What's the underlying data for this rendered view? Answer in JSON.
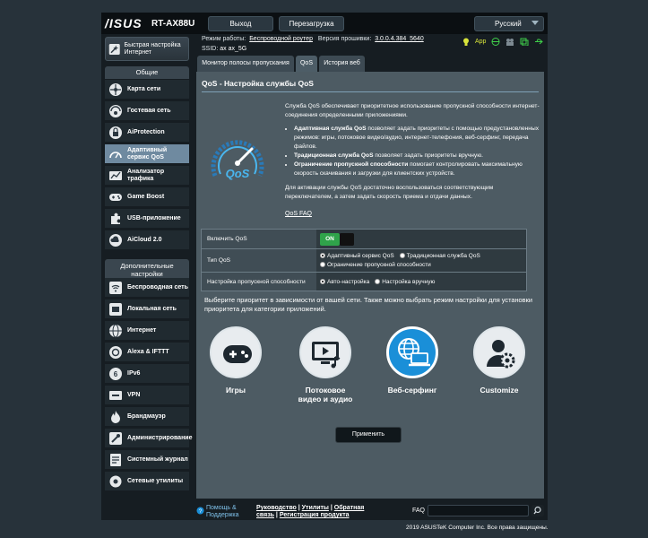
{
  "header": {
    "logo": "/ISUS",
    "model": "RT-AX88U",
    "logout_label": "Выход",
    "reboot_label": "Перезагрузка",
    "language": "Русский"
  },
  "status": {
    "mode_label": "Режим работы:",
    "mode_value": "Беспроводной роутер",
    "fw_label": "Версия прошивки:",
    "fw_value": "3.0.0.4.384_5640",
    "ssid_label": "SSID:",
    "ssid_1": "ax",
    "ssid_2": "ax_5G",
    "app_label": "App"
  },
  "sidebar": {
    "qis_label": "Быстрая настройка Интернет",
    "general_header": "Общие",
    "general_items": [
      {
        "label": "Карта сети"
      },
      {
        "label": "Гостевая сеть"
      },
      {
        "label": "AiProtection"
      },
      {
        "label": "Адаптивный сервис QoS"
      },
      {
        "label": "Анализатор трафика"
      },
      {
        "label": "Game Boost"
      },
      {
        "label": "USB-приложение"
      },
      {
        "label": "AiCloud 2.0"
      }
    ],
    "advanced_header": "Дополнительные настройки",
    "advanced_items": [
      {
        "label": "Беспроводная сеть"
      },
      {
        "label": "Локальная сеть"
      },
      {
        "label": "Интернет"
      },
      {
        "label": "Alexa & IFTTT"
      },
      {
        "label": "IPv6"
      },
      {
        "label": "VPN"
      },
      {
        "label": "Брандмауэр"
      },
      {
        "label": "Администрирование"
      },
      {
        "label": "Системный журнал"
      },
      {
        "label": "Сетевые утилиты"
      }
    ]
  },
  "tabs": [
    {
      "label": "Монитор полосы пропускания"
    },
    {
      "label": "QoS"
    },
    {
      "label": "История веб"
    }
  ],
  "main": {
    "title": "QoS - Настройка службы QoS",
    "intro": "Служба QoS обеспечивает приоритетное использование пропускной способности интернет-соединения определенными приложениями.",
    "b1_bold": "Адаптивная служба QoS",
    "b1_text": " позволяет задать приоритеты с помощью предустановленных режимов: игры, потоковое видео/аудио, интернет-телефония, веб-серфинг, передача файлов.",
    "b2_bold": "Традиционная служба QoS",
    "b2_text": " позволяет задать приоритеты вручную.",
    "b3_bold": "Ограничение пропускной способности",
    "b3_text": " помогает контролировать максимальную скорость скачивания и загрузки для клиентских устройств.",
    "activate": "Для активации службы QoS достаточно воспользоваться соответствующим переключателем, а затем задать скорость приема и отдачи данных.",
    "qos_faq": "QoS FAQ",
    "qos_logo_text": "QoS"
  },
  "settings": {
    "enable_label": "Включить QoS",
    "enable_state": "ON",
    "type_label": "Тип QoS",
    "type_options": [
      "Адаптивный сервис QoS",
      "Традиционная служба QoS",
      "Ограничение пропускной способности"
    ],
    "type_selected": 0,
    "bw_label": "Настройка пропускной способности",
    "bw_options": [
      "Авто-настройка",
      "Настройка вручную"
    ],
    "bw_selected": 0
  },
  "priority": {
    "text": "Выберите приоритет в зависимости от вашей сети. Также можно выбрать режим настройки для установки приоритета для категории приложений.",
    "categories": [
      {
        "label": "Игры",
        "icon": "gamepad-icon"
      },
      {
        "label": "Потоковое видео и аудио",
        "icon": "media-icon"
      },
      {
        "label": "Веб-серфинг",
        "icon": "globe-laptop-icon"
      },
      {
        "label": "Customize",
        "icon": "person-gear-icon"
      }
    ],
    "selected": 2
  },
  "apply_label": "Применить",
  "footer": {
    "help_label": "Помощь & Поддержка",
    "links_line1_a": "Руководство",
    "links_line1_b": "Утилиты",
    "links_line1_c": "Обратная",
    "links_line2_a": "связь",
    "links_line2_b": "Регистрация продукта",
    "faq_label": "FAQ",
    "copyright": "2019 ASUSTeK Computer Inc. Все права защищены."
  },
  "colors": {
    "accent": "#1a8fd8",
    "toggle_on": "#2fa34a",
    "panel": "#4d5b63",
    "sidebar_active": "#6f8aa0"
  }
}
